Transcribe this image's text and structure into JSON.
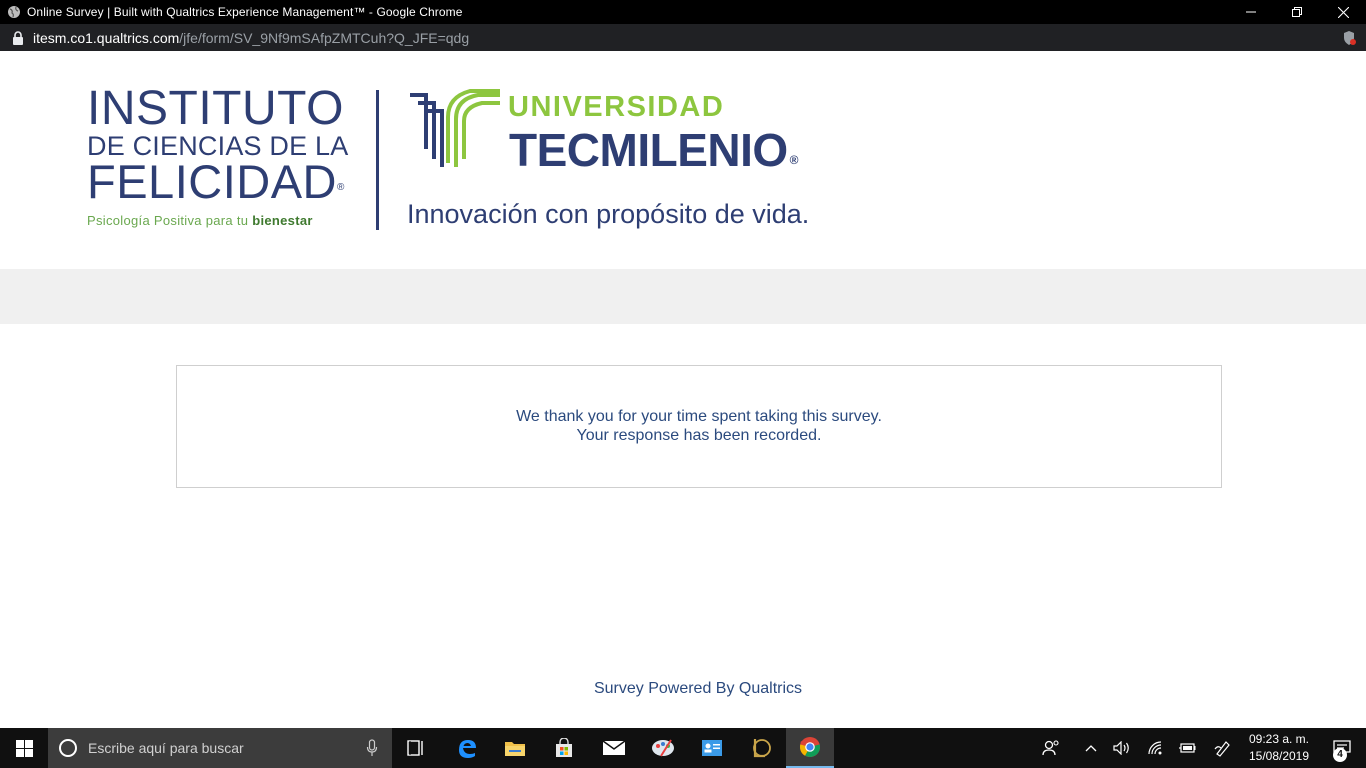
{
  "window": {
    "title": "Online Survey | Built with Qualtrics Experience Management™ - Google Chrome"
  },
  "addressbar": {
    "host": "itesm.co1.qualtrics.com",
    "path": "/jfe/form/SV_9Nf9mSAfpZMTCuh?Q_JFE=qdg"
  },
  "header": {
    "icf": {
      "line1": "INSTITUTO",
      "line2": "DE CIENCIAS DE LA",
      "line3": "FELICIDAD",
      "registered": "®",
      "tagline_prefix": "Psicología Positiva para tu ",
      "tagline_bold": "bienestar"
    },
    "tecmilenio": {
      "line1": "UNIVERSIDAD",
      "line2": "TECMILENIO",
      "registered": "®",
      "slogan": "Innovación con propósito de vida."
    }
  },
  "main": {
    "thanks_line1": "We thank you for your time spent taking this survey.",
    "thanks_line2": "Your response has been recorded.",
    "powered_by": "Survey Powered By Qualtrics"
  },
  "taskbar": {
    "search_placeholder": "Escribe aquí para buscar",
    "time": "09:23 a. m.",
    "date": "15/08/2019",
    "notification_count": "4"
  },
  "colors": {
    "brand_navy": "#2e3e73",
    "brand_green": "#8dc63f",
    "text_blue": "#2b4a7e",
    "taskbar": "#101010"
  }
}
